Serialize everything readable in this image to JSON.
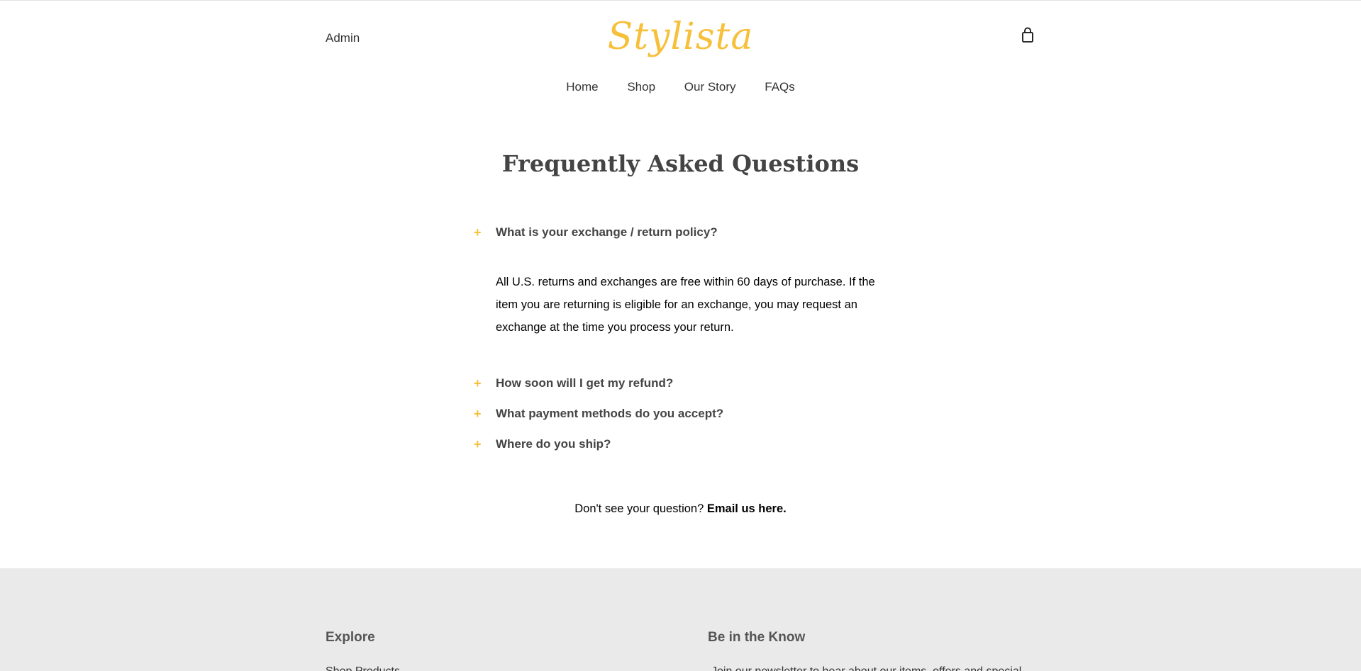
{
  "header": {
    "admin_label": "Admin",
    "logo_text": "Stylista",
    "cart_icon": "shopping-bag-icon",
    "accent_color": "#f7c03b"
  },
  "nav": {
    "items": [
      "Home",
      "Shop",
      "Our Story",
      "FAQs"
    ]
  },
  "main": {
    "title": "Frequently Asked Questions",
    "faqs": [
      {
        "question": "What is your exchange / return policy?",
        "icon": "plus-icon",
        "answer": "All U.S. returns and exchanges are free within 60 days of purchase. If the item you are returning is eligible for an exchange, you may request an exchange at the time you process your return."
      },
      {
        "question": "How soon will I get my refund?",
        "icon": "plus-icon"
      },
      {
        "question": "What payment methods do you accept?",
        "icon": "plus-icon"
      },
      {
        "question": "Where do you ship?",
        "icon": "plus-icon"
      }
    ],
    "contact_text": "Don't see your question?",
    "contact_link": "Email us here."
  },
  "footer": {
    "explore_heading": "Explore",
    "explore_first_link": "Shop Products",
    "know_heading": "Be in the Know",
    "know_text": "Join our newsletter to hear about our items, offers and special"
  }
}
